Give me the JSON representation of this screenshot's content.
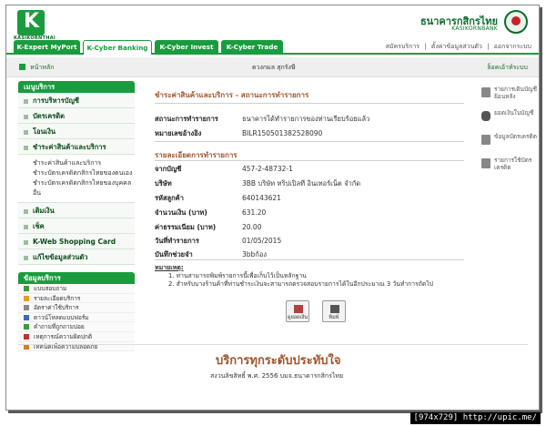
{
  "header": {
    "logo_text": "KASIKORNTHAI",
    "bank_name_th": "ธนาคารกสิกรไทย",
    "bank_name_en": "KASIKORNBANK"
  },
  "tabs": [
    {
      "label": "K-Expert MyPort"
    },
    {
      "label": "K-Cyber Banking"
    },
    {
      "label": "K-Cyber Invest"
    },
    {
      "label": "K-Cyber Trade"
    }
  ],
  "top_links": [
    "สมัครบริการ",
    "|",
    "ตั้งค่าข้อมูลส่วนตัว",
    "|",
    "ออกจากระบบ"
  ],
  "crumb": {
    "home": "หน้าหลัก",
    "user": "ดวงกมล  สุกรังษี",
    "logout": "ล็อคเอ้าท์ระบบ"
  },
  "sidebar": {
    "title": "เมนูบริการ",
    "items": [
      "การบริหารบัญชี",
      "บัตรเครดิต",
      "โอนเงิน",
      "ชำระค่าสินค้าและบริการ"
    ],
    "sub_items": [
      "ชำระค่าสินค้าและบริการ",
      "ชำระบัตรเครดิตกสิกรไทยของตนเอง",
      "ชำระบัตรเครดิตกสิกรไทยของบุคคลอื่น"
    ],
    "items2": [
      "เติมเงิน",
      "เช็ค",
      "K-Web Shopping Card",
      "แก้ไขข้อมูลส่วนตัว"
    ],
    "info_title": "ข้อมูลบริการ",
    "info_items": [
      "แบบสอบถาม",
      "รายละเอียดบริการ",
      "อัตราค่าใช้บริการ",
      "ดาวน์โหลดแบบฟอร์ม",
      "คำถามที่ถูกถามบ่อย",
      "เหตุการณ์ความผิดปกติ",
      "เทคนิคเพื่อความปลอดภัย"
    ]
  },
  "main": {
    "title": "ชำระค่าสินค้าและบริการ - สถานะการทำรายการ",
    "status_label": "สถานะการทำรายการ",
    "status_value": "ธนาคารได้ทำรายการของท่านเรียบร้อยแล้ว",
    "ref_label": "หมายเลขอ้างอิง",
    "ref_value": "BILR150501382528090",
    "detail_title": "รายละเอียดการทำรายการ",
    "details": [
      {
        "label": "จากบัญชี",
        "value": "457-2-48732-1"
      },
      {
        "label": "บริษัท",
        "value": "3BB บริษัท ทริปเปิลที อินเทอร์เน็ต จำกัด"
      },
      {
        "label": "รหัสลูกค้า",
        "value": "640143621"
      },
      {
        "label": "จำนวนเงิน (บาท)",
        "value": "631.20"
      },
      {
        "label": "ค่าธรรมเนียม (บาท)",
        "value": "20.00"
      },
      {
        "label": "วันที่ทำรายการ",
        "value": "01/05/2015"
      },
      {
        "label": "บันทึกช่วยจำ",
        "value": "3bbก้อง"
      }
    ],
    "note_title": "หมายเหตุ:",
    "notes": [
      "1. ท่านสามารถพิมพ์รายการนี้เพื่อเก็บไว้เป็นหลักฐาน",
      "2. สำหรับบางร้านค้าที่ท่านชำระเงินจะสามารถตรวจสอบรายการได้ในอีกประมาณ 3 วันทำการถัดไป"
    ],
    "buttons": [
      "ดูยอดเงิน",
      "พิมพ์"
    ]
  },
  "right_links": [
    "รายการเดินบัญชีย้อนหลัง",
    "ยอดเงินในบัญชี",
    "ข้อมูลบัตรเครดิต",
    "รายการใช้บัตรเครดิต"
  ],
  "footer": {
    "slogan": "บริการทุกระดับประทับใจ",
    "copyright": "สงวนลิขสิทธิ์ พ.ศ. 2556 บมจ.ธนาคารกสิกรไทย"
  },
  "watermark": "[974x729] http://upic.me/"
}
